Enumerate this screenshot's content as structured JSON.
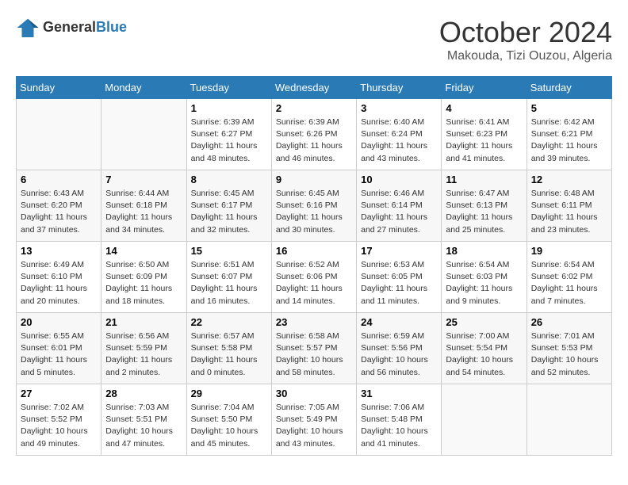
{
  "logo": {
    "text1": "General",
    "text2": "Blue"
  },
  "title": "October 2024",
  "subtitle": "Makouda, Tizi Ouzou, Algeria",
  "days_of_week": [
    "Sunday",
    "Monday",
    "Tuesday",
    "Wednesday",
    "Thursday",
    "Friday",
    "Saturday"
  ],
  "weeks": [
    [
      {
        "day": "",
        "info": ""
      },
      {
        "day": "",
        "info": ""
      },
      {
        "day": "1",
        "info": "Sunrise: 6:39 AM\nSunset: 6:27 PM\nDaylight: 11 hours and 48 minutes."
      },
      {
        "day": "2",
        "info": "Sunrise: 6:39 AM\nSunset: 6:26 PM\nDaylight: 11 hours and 46 minutes."
      },
      {
        "day": "3",
        "info": "Sunrise: 6:40 AM\nSunset: 6:24 PM\nDaylight: 11 hours and 43 minutes."
      },
      {
        "day": "4",
        "info": "Sunrise: 6:41 AM\nSunset: 6:23 PM\nDaylight: 11 hours and 41 minutes."
      },
      {
        "day": "5",
        "info": "Sunrise: 6:42 AM\nSunset: 6:21 PM\nDaylight: 11 hours and 39 minutes."
      }
    ],
    [
      {
        "day": "6",
        "info": "Sunrise: 6:43 AM\nSunset: 6:20 PM\nDaylight: 11 hours and 37 minutes."
      },
      {
        "day": "7",
        "info": "Sunrise: 6:44 AM\nSunset: 6:18 PM\nDaylight: 11 hours and 34 minutes."
      },
      {
        "day": "8",
        "info": "Sunrise: 6:45 AM\nSunset: 6:17 PM\nDaylight: 11 hours and 32 minutes."
      },
      {
        "day": "9",
        "info": "Sunrise: 6:45 AM\nSunset: 6:16 PM\nDaylight: 11 hours and 30 minutes."
      },
      {
        "day": "10",
        "info": "Sunrise: 6:46 AM\nSunset: 6:14 PM\nDaylight: 11 hours and 27 minutes."
      },
      {
        "day": "11",
        "info": "Sunrise: 6:47 AM\nSunset: 6:13 PM\nDaylight: 11 hours and 25 minutes."
      },
      {
        "day": "12",
        "info": "Sunrise: 6:48 AM\nSunset: 6:11 PM\nDaylight: 11 hours and 23 minutes."
      }
    ],
    [
      {
        "day": "13",
        "info": "Sunrise: 6:49 AM\nSunset: 6:10 PM\nDaylight: 11 hours and 20 minutes."
      },
      {
        "day": "14",
        "info": "Sunrise: 6:50 AM\nSunset: 6:09 PM\nDaylight: 11 hours and 18 minutes."
      },
      {
        "day": "15",
        "info": "Sunrise: 6:51 AM\nSunset: 6:07 PM\nDaylight: 11 hours and 16 minutes."
      },
      {
        "day": "16",
        "info": "Sunrise: 6:52 AM\nSunset: 6:06 PM\nDaylight: 11 hours and 14 minutes."
      },
      {
        "day": "17",
        "info": "Sunrise: 6:53 AM\nSunset: 6:05 PM\nDaylight: 11 hours and 11 minutes."
      },
      {
        "day": "18",
        "info": "Sunrise: 6:54 AM\nSunset: 6:03 PM\nDaylight: 11 hours and 9 minutes."
      },
      {
        "day": "19",
        "info": "Sunrise: 6:54 AM\nSunset: 6:02 PM\nDaylight: 11 hours and 7 minutes."
      }
    ],
    [
      {
        "day": "20",
        "info": "Sunrise: 6:55 AM\nSunset: 6:01 PM\nDaylight: 11 hours and 5 minutes."
      },
      {
        "day": "21",
        "info": "Sunrise: 6:56 AM\nSunset: 5:59 PM\nDaylight: 11 hours and 2 minutes."
      },
      {
        "day": "22",
        "info": "Sunrise: 6:57 AM\nSunset: 5:58 PM\nDaylight: 11 hours and 0 minutes."
      },
      {
        "day": "23",
        "info": "Sunrise: 6:58 AM\nSunset: 5:57 PM\nDaylight: 10 hours and 58 minutes."
      },
      {
        "day": "24",
        "info": "Sunrise: 6:59 AM\nSunset: 5:56 PM\nDaylight: 10 hours and 56 minutes."
      },
      {
        "day": "25",
        "info": "Sunrise: 7:00 AM\nSunset: 5:54 PM\nDaylight: 10 hours and 54 minutes."
      },
      {
        "day": "26",
        "info": "Sunrise: 7:01 AM\nSunset: 5:53 PM\nDaylight: 10 hours and 52 minutes."
      }
    ],
    [
      {
        "day": "27",
        "info": "Sunrise: 7:02 AM\nSunset: 5:52 PM\nDaylight: 10 hours and 49 minutes."
      },
      {
        "day": "28",
        "info": "Sunrise: 7:03 AM\nSunset: 5:51 PM\nDaylight: 10 hours and 47 minutes."
      },
      {
        "day": "29",
        "info": "Sunrise: 7:04 AM\nSunset: 5:50 PM\nDaylight: 10 hours and 45 minutes."
      },
      {
        "day": "30",
        "info": "Sunrise: 7:05 AM\nSunset: 5:49 PM\nDaylight: 10 hours and 43 minutes."
      },
      {
        "day": "31",
        "info": "Sunrise: 7:06 AM\nSunset: 5:48 PM\nDaylight: 10 hours and 41 minutes."
      },
      {
        "day": "",
        "info": ""
      },
      {
        "day": "",
        "info": ""
      }
    ]
  ]
}
